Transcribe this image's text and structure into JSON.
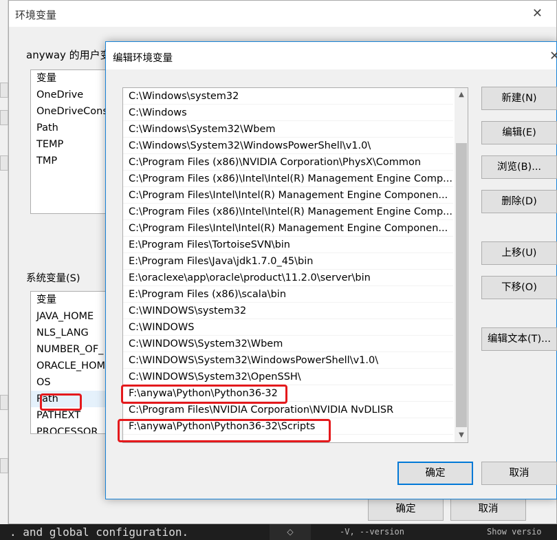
{
  "env_window": {
    "title": "环境变量",
    "close_glyph": "✕",
    "user_section_label": "anyway 的用户变",
    "user_vars": [
      "变量",
      "OneDrive",
      "OneDriveCons",
      "Path",
      "TEMP",
      "TMP"
    ],
    "system_section_label": "系统变量(S)",
    "system_vars": [
      "变量",
      "JAVA_HOME",
      "NLS_LANG",
      "NUMBER_OF_",
      "ORACLE_HOM",
      "OS",
      "Path",
      "PATHEXT",
      "PROCESSOR_"
    ],
    "ok_label": "确定",
    "cancel_label": "取消"
  },
  "edit_dialog": {
    "title": "编辑环境变量",
    "close_glyph": "✕",
    "paths": [
      "C:\\Windows\\system32",
      "C:\\Windows",
      "C:\\Windows\\System32\\Wbem",
      "C:\\Windows\\System32\\WindowsPowerShell\\v1.0\\",
      "C:\\Program Files (x86)\\NVIDIA Corporation\\PhysX\\Common",
      "C:\\Program Files (x86)\\Intel\\Intel(R) Management Engine Comp...",
      "C:\\Program Files\\Intel\\Intel(R) Management Engine Componen...",
      "C:\\Program Files (x86)\\Intel\\Intel(R) Management Engine Comp...",
      "C:\\Program Files\\Intel\\Intel(R) Management Engine Componen...",
      "E:\\Program Files\\TortoiseSVN\\bin",
      "E:\\Program Files\\Java\\jdk1.7.0_45\\bin",
      "E:\\oraclexe\\app\\oracle\\product\\11.2.0\\server\\bin",
      "E:\\Program Files (x86)\\scala\\bin",
      "C:\\WINDOWS\\system32",
      "C:\\WINDOWS",
      "C:\\WINDOWS\\System32\\Wbem",
      "C:\\WINDOWS\\System32\\WindowsPowerShell\\v1.0\\",
      "C:\\WINDOWS\\System32\\OpenSSH\\",
      "F:\\anywa\\Python\\Python36-32",
      "C:\\Program Files\\NVIDIA Corporation\\NVIDIA NvDLISR",
      "F:\\anywa\\Python\\Python36-32\\Scripts"
    ],
    "buttons": {
      "new": "新建(N)",
      "edit": "编辑(E)",
      "browse": "浏览(B)...",
      "delete": "删除(D)",
      "move_up": "上移(U)",
      "move_down": "下移(O)",
      "edit_text": "编辑文本(T)...",
      "ok": "确定",
      "cancel": "取消"
    }
  },
  "background_bottom": {
    "left_text": ". and global configuration.",
    "mid_text": "◇",
    "right_text_1": "-V, --version",
    "right_text_2": "Show versio"
  },
  "colors": {
    "highlight_red": "#e4191c",
    "accent_blue": "#0078d7"
  }
}
